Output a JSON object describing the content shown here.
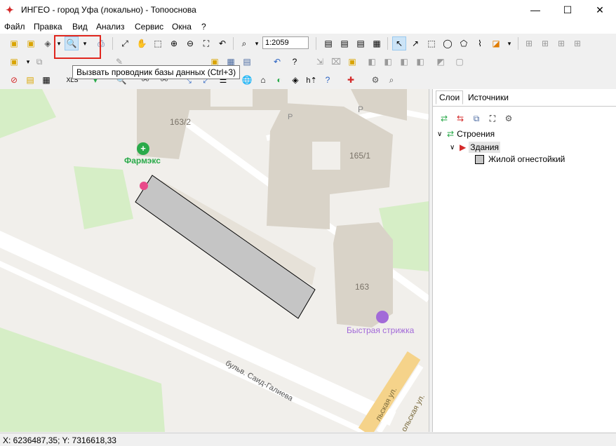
{
  "window": {
    "title": "ИНГЕО - город Уфа (локально) - Топооснова",
    "min": "—",
    "max": "☐",
    "close": "✕"
  },
  "menu": [
    "Файл",
    "Правка",
    "Вид",
    "Анализ",
    "Сервис",
    "Окна",
    "?"
  ],
  "toolbar": {
    "scale_value": "1:2059",
    "xls_label": "XLS"
  },
  "tooltip": "Вызвать проводник базы данных (Ctrl+3)",
  "map": {
    "labels": {
      "building_163_2": "163/2",
      "building_165_1": "165/1",
      "building_163": "163",
      "pharmacy": "Фармэкс",
      "barber": "Быстрая стрижка",
      "street_bulvar": "бульв. Саид-Галиева",
      "street_ul": "льская ул.",
      "street_ul2": "ольская ул.",
      "parking1": "P",
      "parking2": "P"
    },
    "colors": {
      "background": "#f1efeb",
      "park": "#d6eec6",
      "building": "#d9d3c8",
      "selected_polygon": "#c5c5c5",
      "pharmacy": "#2aaa4a",
      "barber": "#a26ad8"
    }
  },
  "panel": {
    "tabs": [
      "Слои",
      "Источники"
    ],
    "tree": {
      "group": "Строения",
      "layer": "Здания",
      "style": "Жилой огнестойкий"
    }
  },
  "status": "X: 6236487,35; Y: 7316618,33"
}
